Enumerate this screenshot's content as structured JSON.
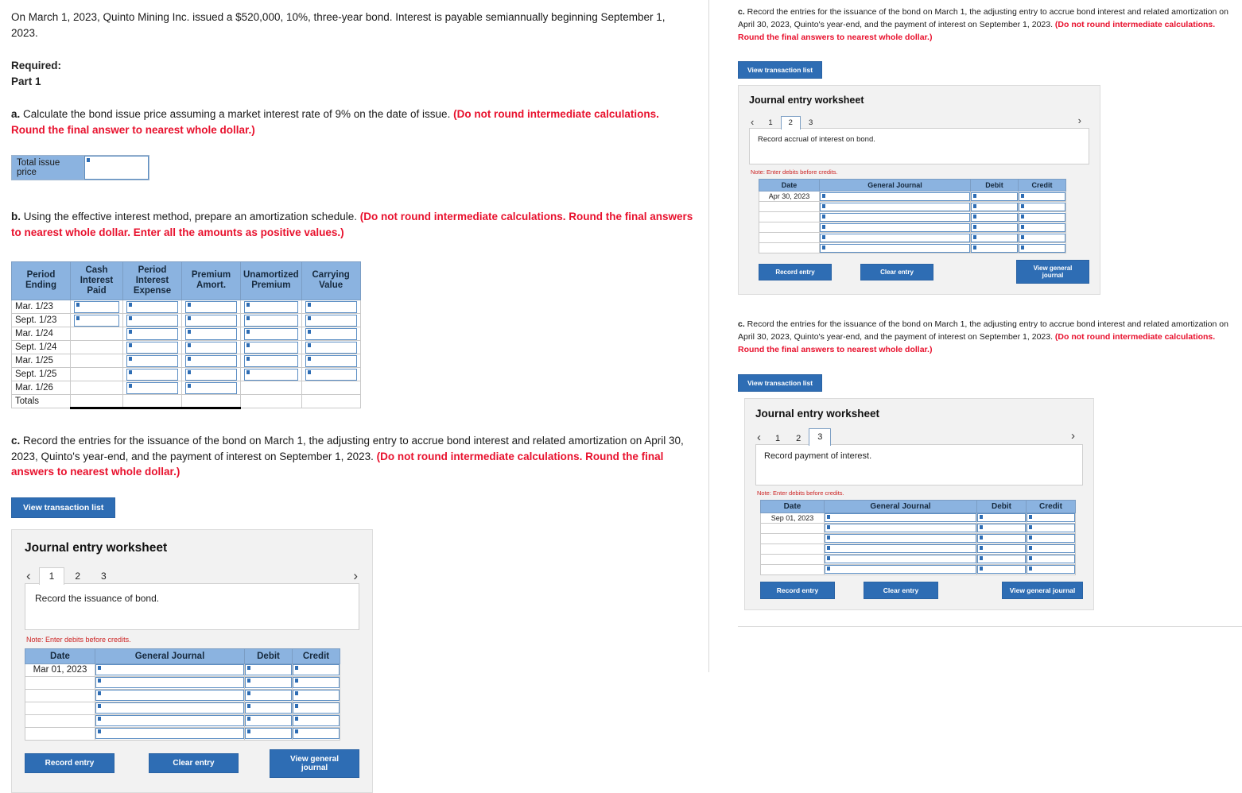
{
  "left": {
    "intro": "On March 1, 2023, Quinto Mining Inc. issued a $520,000, 10%, three-year bond. Interest is payable semiannually beginning September 1, 2023.",
    "required_label": "Required:",
    "part_label": "Part 1",
    "question_a": {
      "marker": "a.",
      "text": " Calculate the bond issue price assuming a market interest rate of 9% on the date of issue. ",
      "red": "(Do not round intermediate calculations. Round the final answer to nearest whole dollar.)"
    },
    "issue_price": {
      "label": "Total issue price",
      "value": ""
    },
    "question_b": {
      "marker": "b.",
      "text": " Using the effective interest method, prepare an amortization schedule. ",
      "red": "(Do not round intermediate calculations. Round the final answers to nearest whole dollar. Enter all the amounts as positive values.)"
    },
    "amortization": {
      "headers": [
        "Period Ending",
        "Cash Interest Paid",
        "Period Interest Expense",
        "Premium Amort.",
        "Unamortized Premium",
        "Carrying Value"
      ],
      "rows": [
        {
          "period": "Mar. 1/23",
          "inputs": [
            true,
            true,
            true,
            true,
            true
          ]
        },
        {
          "period": "Sept. 1/23",
          "inputs": [
            true,
            true,
            true,
            true,
            true
          ]
        },
        {
          "period": "Mar. 1/24",
          "inputs": [
            false,
            true,
            true,
            true,
            true
          ]
        },
        {
          "period": "Sept. 1/24",
          "inputs": [
            false,
            true,
            true,
            true,
            true
          ]
        },
        {
          "period": "Mar. 1/25",
          "inputs": [
            false,
            true,
            true,
            true,
            true
          ]
        },
        {
          "period": "Sept. 1/25",
          "inputs": [
            false,
            true,
            true,
            true,
            true
          ]
        },
        {
          "period": "Mar. 1/26",
          "inputs": [
            false,
            true,
            true,
            false,
            false
          ]
        }
      ],
      "totals_label": "Totals"
    },
    "question_c": {
      "marker": "c.",
      "text": " Record the entries for the issuance of the bond on March 1, the adjusting entry to accrue bond interest and related amortization on April 30, 2023, Quinto's year-end, and the payment of interest on September 1, 2023. ",
      "red": "(Do not round intermediate calculations. Round the final answers to nearest whole dollar.)"
    },
    "view_transaction_list": "View transaction list",
    "worksheet": {
      "title": "Journal entry worksheet",
      "tabs": [
        "1",
        "2",
        "3"
      ],
      "active_tab": "1",
      "prev_arrow": "‹",
      "next_arrow": "›",
      "description": "Record the issuance of bond.",
      "note": "Note: Enter debits before credits.",
      "table": {
        "headers": [
          "Date",
          "General Journal",
          "Debit",
          "Credit"
        ],
        "rows": [
          {
            "date": "Mar 01, 2023"
          },
          {
            "date": ""
          },
          {
            "date": ""
          },
          {
            "date": ""
          },
          {
            "date": ""
          },
          {
            "date": ""
          }
        ]
      },
      "buttons": {
        "record": "Record entry",
        "clear": "Clear entry",
        "view_journal": "View general journal"
      }
    }
  },
  "right": {
    "section1": {
      "question_c": {
        "marker": "c.",
        "text": " Record the entries for the issuance of the bond on March 1, the adjusting entry to accrue bond interest and related amortization on April 30, 2023, Quinto's year-end, and the payment of interest on September 1, 2023. ",
        "red": "(Do not round intermediate calculations. Round the final answers to nearest whole dollar.)"
      },
      "view_transaction_list": "View transaction list",
      "worksheet": {
        "title": "Journal entry worksheet",
        "tabs": [
          "1",
          "2",
          "3"
        ],
        "active_tab": "2",
        "prev_arrow": "‹",
        "next_arrow": "›",
        "description": "Record accrual of interest on bond.",
        "note": "Note: Enter debits before credits.",
        "table": {
          "headers": [
            "Date",
            "General Journal",
            "Debit",
            "Credit"
          ],
          "rows": [
            {
              "date": "Apr 30, 2023"
            },
            {
              "date": ""
            },
            {
              "date": ""
            },
            {
              "date": ""
            },
            {
              "date": ""
            },
            {
              "date": ""
            }
          ]
        },
        "buttons": {
          "record": "Record entry",
          "clear": "Clear entry",
          "view_journal": "View general journal"
        }
      }
    },
    "section2": {
      "question_c": {
        "marker": "c.",
        "text": " Record the entries for the issuance of the bond on March 1, the adjusting entry to accrue bond interest and related amortization on April 30, 2023, Quinto's year-end, and the payment of interest on September 1, 2023. ",
        "red": "(Do not round intermediate calculations. Round the final answers to nearest whole dollar.)"
      },
      "view_transaction_list": "View transaction list",
      "worksheet": {
        "title": "Journal entry worksheet",
        "tabs": [
          "1",
          "2",
          "3"
        ],
        "active_tab": "3",
        "prev_arrow": "‹",
        "next_arrow": "›",
        "description": "Record payment of interest.",
        "note": "Note: Enter debits before credits.",
        "table": {
          "headers": [
            "Date",
            "General Journal",
            "Debit",
            "Credit"
          ],
          "rows": [
            {
              "date": "Sep 01, 2023"
            },
            {
              "date": ""
            },
            {
              "date": ""
            },
            {
              "date": ""
            },
            {
              "date": ""
            },
            {
              "date": ""
            }
          ]
        },
        "buttons": {
          "record": "Record entry",
          "clear": "Clear entry",
          "view_journal": "View general journal"
        }
      }
    }
  },
  "colors": {
    "header_blue": "#8bb3e0",
    "button_blue": "#2e6db4",
    "red_text": "#e8112d",
    "note_red": "#cc2222",
    "input_border": "#5b8ec4"
  }
}
